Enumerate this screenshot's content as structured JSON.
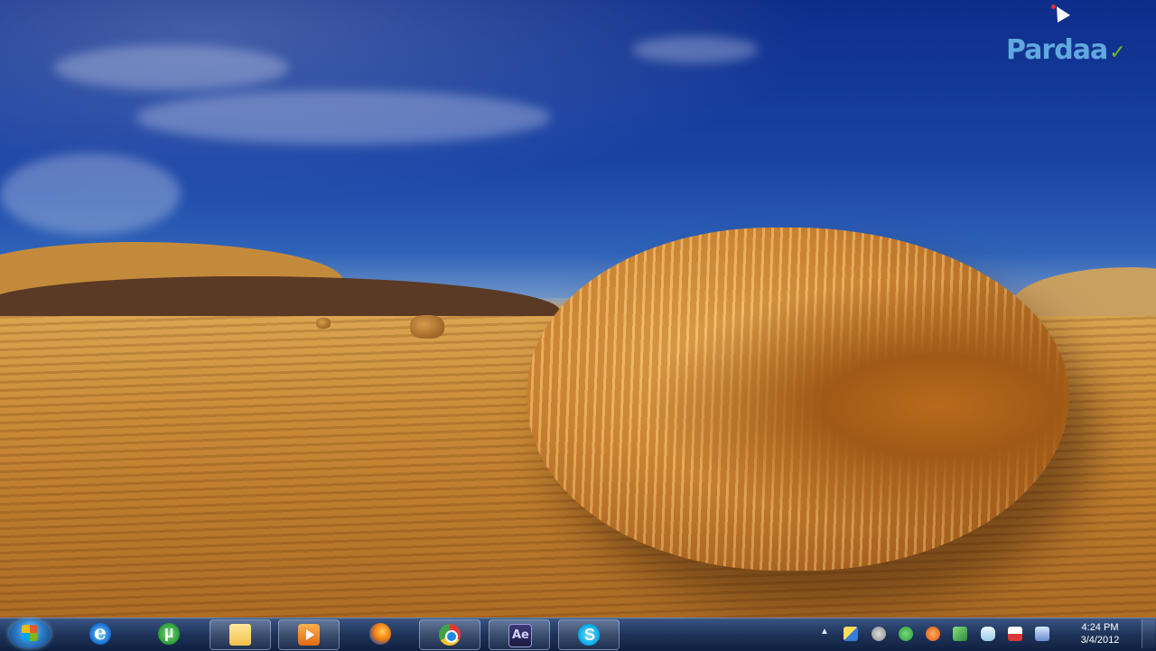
{
  "desktop": {
    "watermark_logo": "Pardaa"
  },
  "taskbar": {
    "start_button": "start-orb-icon",
    "items": [
      {
        "name": "internet-explorer",
        "icon": "ie-icon",
        "pinned": true
      },
      {
        "name": "utorrent",
        "icon": "utorrent-icon",
        "pinned": false
      },
      {
        "name": "windows-explorer",
        "icon": "folder-icon",
        "pinned": true
      },
      {
        "name": "media-player",
        "icon": "media-player-icon",
        "pinned": true
      },
      {
        "name": "firefox",
        "icon": "firefox-icon",
        "pinned": false
      },
      {
        "name": "chrome",
        "icon": "chrome-icon",
        "pinned": true
      },
      {
        "name": "after-effects",
        "icon": "after-effects-icon",
        "pinned": true
      },
      {
        "name": "skype",
        "icon": "skype-icon",
        "pinned": true
      }
    ]
  },
  "tray": {
    "overflow_arrow": "▲",
    "clock": {
      "time": "4:24 PM",
      "date": "3/4/2012"
    }
  }
}
